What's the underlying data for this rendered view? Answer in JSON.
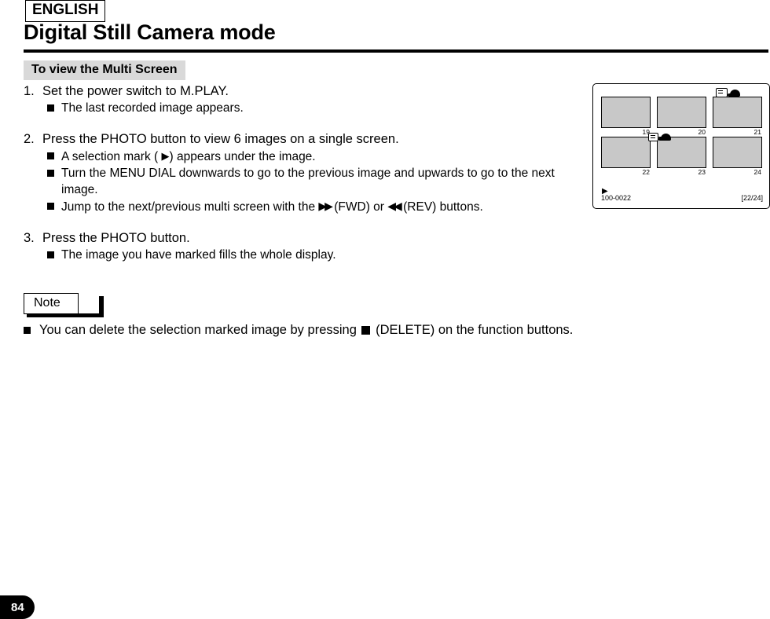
{
  "header": {
    "language_badge": "ENGLISH",
    "title": "Digital Still Camera mode"
  },
  "section": {
    "heading": "To view the Multi Screen"
  },
  "steps": [
    {
      "number": "1.",
      "text": "Set the power switch to M.PLAY.",
      "subs": [
        {
          "text": "The last recorded image appears."
        }
      ]
    },
    {
      "number": "2.",
      "text": "Press the PHOTO button to view 6 images on a single screen.",
      "subs": [
        {
          "pre": "A selection mark (",
          "glyph": "▶",
          "post": ") appears under the image."
        },
        {
          "text": "Turn the MENU DIAL downwards to go to the previous image and upwards to go to the next image."
        },
        {
          "pre": "Jump to the next/previous multi screen with the",
          "glyph_fwd": "▶▶",
          "mid": "(FWD) or",
          "glyph_rev": "◀◀",
          "post": "(REV) buttons."
        }
      ]
    },
    {
      "number": "3.",
      "text": "Press the PHOTO button.",
      "subs": [
        {
          "text": "The image you have marked fills the whole display."
        }
      ]
    }
  ],
  "note": {
    "label": "Note",
    "text_before": "You can delete the selection marked image by pressing",
    "text_after": "(DELETE) on the function buttons."
  },
  "lcd": {
    "top_icons": [
      "card-icon",
      "hand-icon"
    ],
    "row2_icons": [
      "card-icon",
      "hand-icon"
    ],
    "thumbnails": [
      {
        "number": "19"
      },
      {
        "number": "20"
      },
      {
        "number": "21"
      },
      {
        "number": "22"
      },
      {
        "number": "23"
      },
      {
        "number": "24"
      }
    ],
    "selection_mark": "▶",
    "file_label": "100-0022",
    "counter": "[22/24]"
  },
  "page": {
    "number": "84"
  },
  "colors": {
    "heading_bg": "#d9d9d9",
    "thumb_fill": "#c8c8c8",
    "rule": "#000000"
  }
}
